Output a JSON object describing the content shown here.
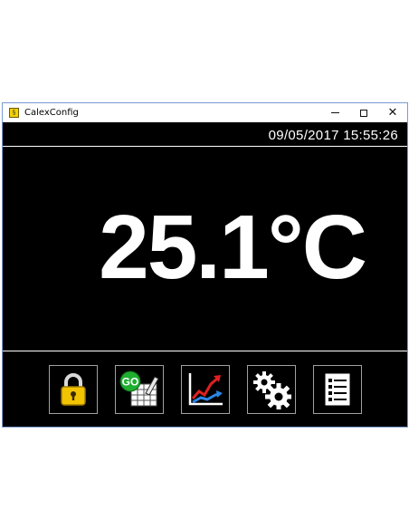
{
  "window": {
    "title": "CalexConfig",
    "app_icon_glyph": "§",
    "close_glyph": "✕"
  },
  "status": {
    "datetime": "09/05/2017 15:55:26"
  },
  "reading": {
    "value": "25.1°C"
  },
  "toolbar": {
    "buttons": [
      {
        "icon": "padlock-icon"
      },
      {
        "icon": "go-logging-icon",
        "badge": "GO"
      },
      {
        "icon": "trend-chart-icon"
      },
      {
        "icon": "gears-icon"
      },
      {
        "icon": "checklist-icon"
      }
    ]
  },
  "colors": {
    "background": "#000000",
    "text": "#ffffff",
    "padlock": "#f2c400",
    "go_badge": "#1fae2f",
    "trend_red": "#e02020",
    "trend_blue": "#2b86e6"
  }
}
